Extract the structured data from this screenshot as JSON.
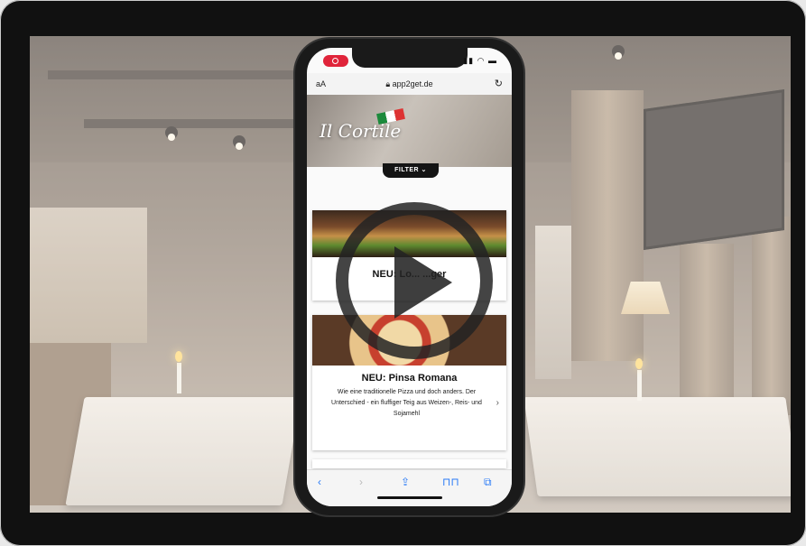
{
  "video": {
    "play_icon": "play-icon"
  },
  "phone": {
    "status": {
      "record_icon": "screen-record-icon",
      "signal": "ᐧll",
      "wifi": "wifi-icon",
      "battery": "battery-icon"
    },
    "browser": {
      "text_size_label": "aA",
      "url": "app2get.de",
      "lock_icon": "lock-icon",
      "reload_icon": "reload-icon"
    },
    "hero": {
      "logo_text": "Il Cortile"
    },
    "filter_label": "FILTER",
    "cards": [
      {
        "title": "NEU: Lo... ...ger"
      },
      {
        "title": "NEU: Pinsa Romana",
        "description": "Wie eine traditionelle Pizza und doch anders. Der Unterschied - ein fluffiger Teig aus Weizen-, Reis- und Sojamehl"
      }
    ],
    "toolbar": {
      "back_icon": "chevron-left-icon",
      "forward_icon": "chevron-right-icon",
      "share_icon": "share-icon",
      "bookmarks_icon": "book-icon",
      "tabs_icon": "tabs-icon"
    }
  },
  "colors": {
    "record": "#e0243a",
    "link_blue": "#2a7bf6",
    "frame": "#111111"
  }
}
